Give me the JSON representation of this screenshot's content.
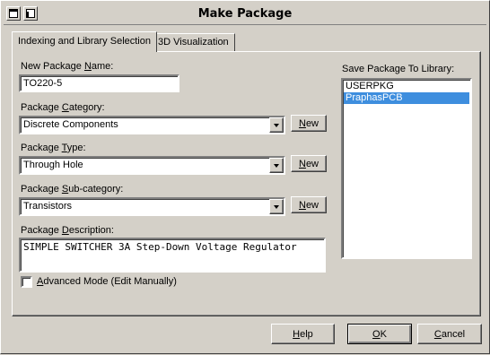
{
  "window": {
    "title": "Make Package"
  },
  "tabs": [
    {
      "label": "Indexing and Library Selection",
      "active": true
    },
    {
      "label": "3D Visualization",
      "active": false
    }
  ],
  "fields": {
    "name_label_pre": "New Package ",
    "name_label_ul": "N",
    "name_label_post": "ame:",
    "name_value": "TO220-5",
    "category_label_pre": "Package ",
    "category_label_ul": "C",
    "category_label_post": "ategory:",
    "category_value": "Discrete Components",
    "type_label_pre": "Package ",
    "type_label_ul": "T",
    "type_label_post": "ype:",
    "type_value": "Through Hole",
    "subcategory_label_pre": "Package ",
    "subcategory_label_ul": "S",
    "subcategory_label_post": "ub-category:",
    "subcategory_value": "Transistors",
    "description_label_pre": "Package ",
    "description_label_ul": "D",
    "description_label_post": "escription:",
    "description_value": "SIMPLE SWITCHER 3A Step-Down Voltage Regulator",
    "advanced_label_pre": "",
    "advanced_label_ul": "A",
    "advanced_label_post": "dvanced Mode (Edit Manually)"
  },
  "new_button": {
    "label_ul": "N",
    "label_post": "ew"
  },
  "library": {
    "label": "Save Package To Library:",
    "items": [
      {
        "label": "USERPKG",
        "selected": false
      },
      {
        "label": "PraphasPCB",
        "selected": true
      }
    ]
  },
  "buttons": {
    "help_ul": "H",
    "help_post": "elp",
    "ok_ul": "O",
    "ok_post": "K",
    "cancel_ul": "C",
    "cancel_post": "ancel"
  },
  "colors": {
    "face": "#d4d0c8",
    "selection": "#3e8ede"
  }
}
